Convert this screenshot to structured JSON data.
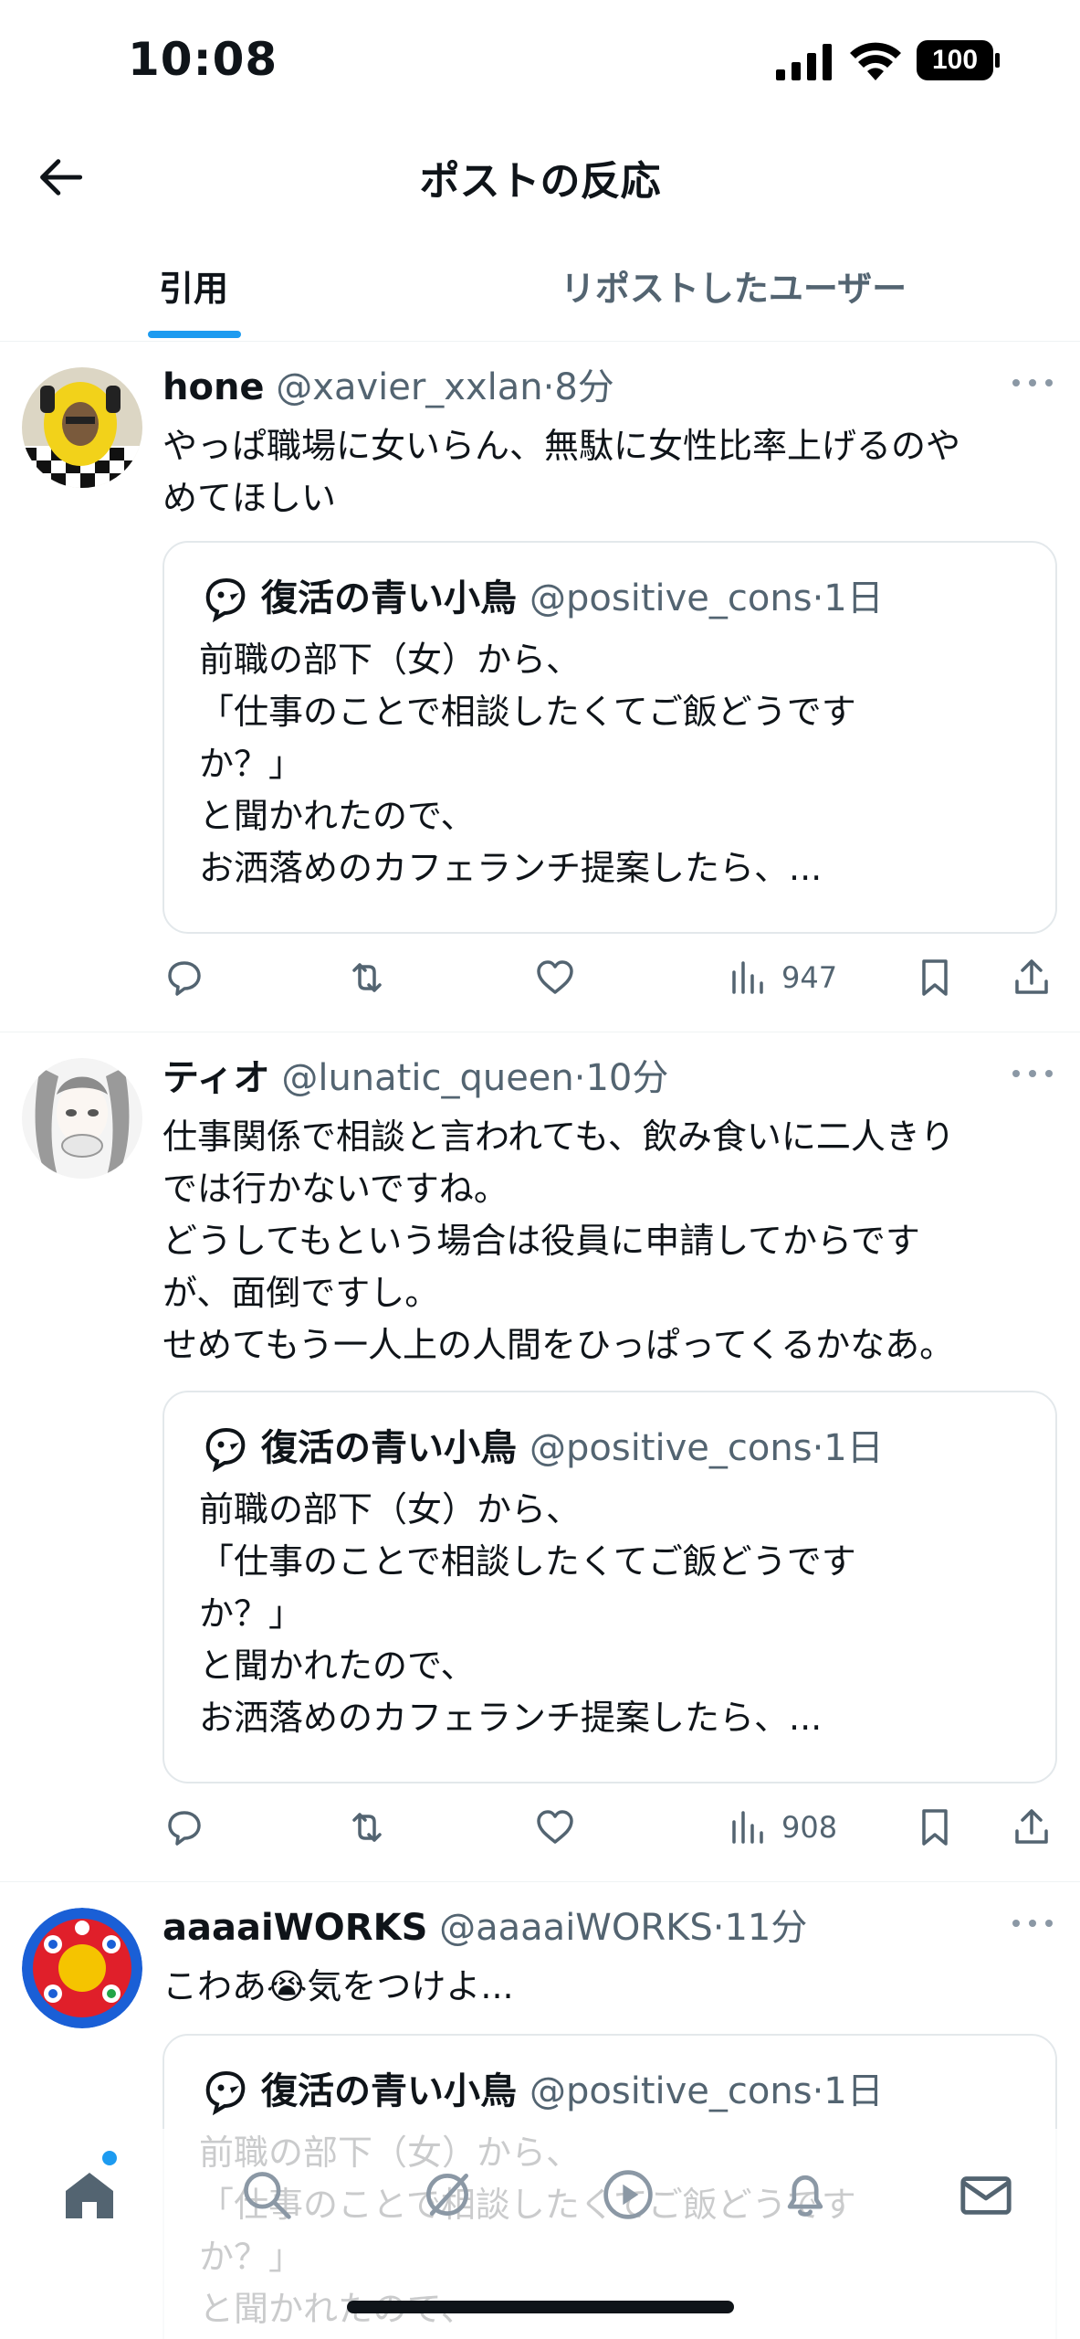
{
  "status_bar": {
    "time": "10:08",
    "battery": "100"
  },
  "header": {
    "title": "ポストの反応"
  },
  "tabs": [
    {
      "label": "引用",
      "selected": true
    },
    {
      "label": "リポストしたユーザー",
      "selected": false
    }
  ],
  "colors": {
    "accent": "#1d9bf0",
    "text": "#0f1419",
    "secondary": "#536471",
    "border": "#eff3f4"
  },
  "quoted_post": {
    "name": "復活の青い小鳥",
    "handle": "@positive_cons",
    "dot": "·",
    "time": "1日",
    "text": "前職の部下（女）から、\n「仕事のことで相談したくてご飯どうです\nか？」\nと聞かれたので、\nお洒落めのカフェランチ提案したら、..."
  },
  "posts": [
    {
      "name": "hone",
      "handle": "@xavier_xxlan",
      "dot": "·",
      "time": "8分",
      "text": "やっぱ職場に女いらん、無駄に女性比率上げるのや\nめてほしい",
      "views": "947"
    },
    {
      "name": "ティオ",
      "handle": "@lunatic_queen",
      "dot": "·",
      "time": "10分",
      "text": "仕事関係で相談と言われても、飲み食いに二人きり\nでは行かないですね。\nどうしてもという場合は役員に申請してからです\nが、面倒ですし。\nせめてもう一人上の人間をひっぱってくるかなあ。",
      "views": "908"
    },
    {
      "name": "aaaaiWORKS",
      "handle": "@aaaaiWORKS",
      "dot": "·",
      "time": "11分",
      "text": "こわあ😭気をつけよ..."
    }
  ],
  "nav": {
    "items": [
      "home-icon",
      "search-icon",
      "grok-icon",
      "video-icon",
      "notifications-icon",
      "messages-icon"
    ]
  }
}
